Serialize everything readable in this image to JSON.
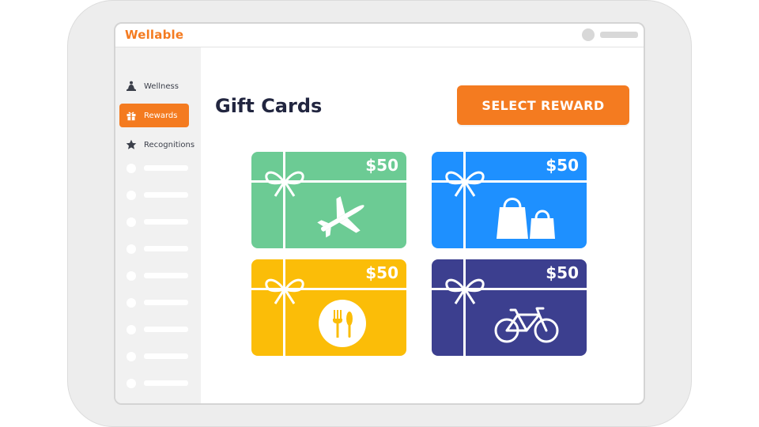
{
  "app": {
    "logo": "Wellable"
  },
  "sidebar": {
    "items": [
      {
        "label": "Wellness",
        "icon": "meditation-icon",
        "active": false
      },
      {
        "label": "Rewards",
        "icon": "gift-icon",
        "active": true
      },
      {
        "label": "Recognitions",
        "icon": "star-icon",
        "active": false
      }
    ]
  },
  "main": {
    "title": "Gift Cards",
    "select_button": "SELECT REWARD"
  },
  "gift_cards": [
    {
      "amount": "$50",
      "category_icon": "airplane-icon",
      "color": "#6ccb94"
    },
    {
      "amount": "$50",
      "category_icon": "shopping-bags-icon",
      "color": "#1e90ff"
    },
    {
      "amount": "$50",
      "category_icon": "fork-knife-icon",
      "color": "#fbbd08"
    },
    {
      "amount": "$50",
      "category_icon": "bicycle-icon",
      "color": "#3c3f8f"
    }
  ],
  "colors": {
    "accent": "#f47b20",
    "title": "#222640"
  }
}
